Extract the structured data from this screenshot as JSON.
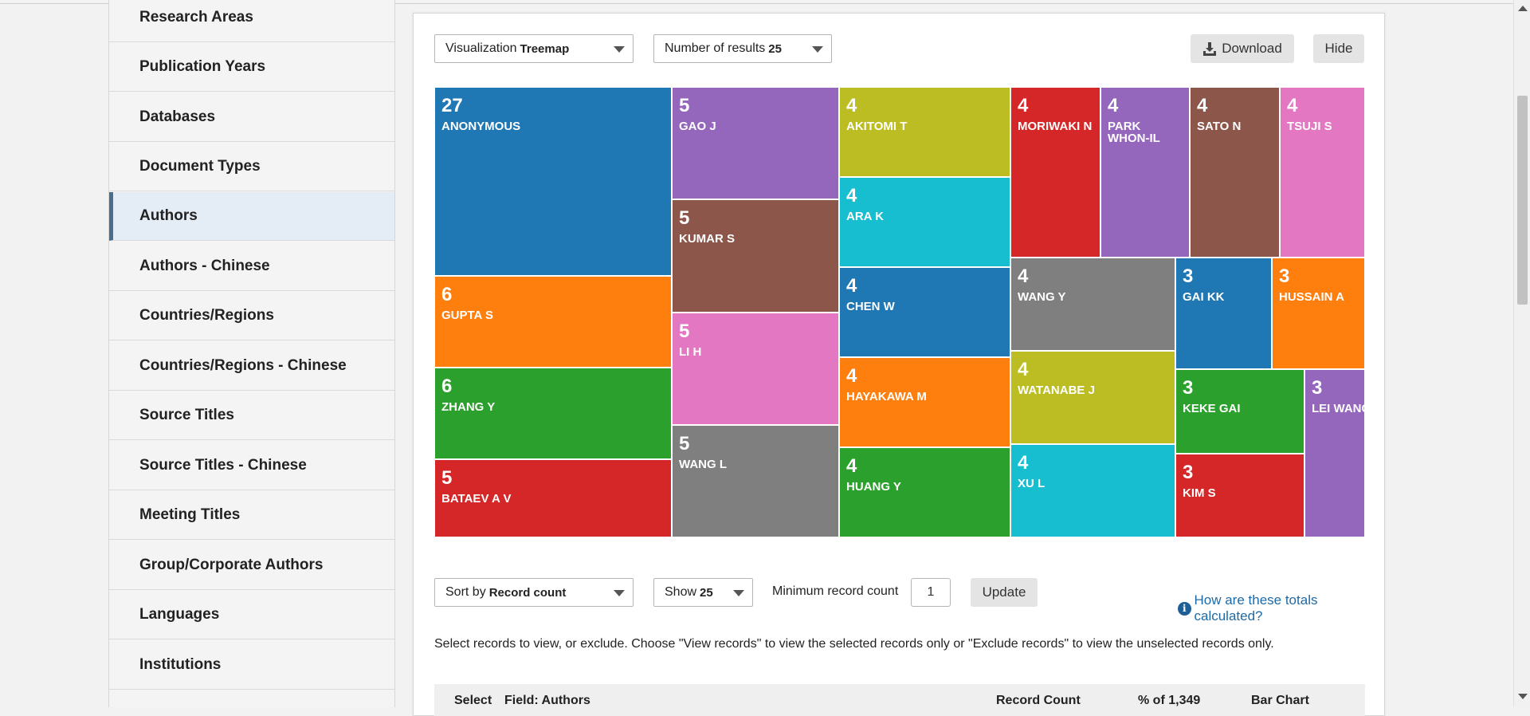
{
  "sidebar": {
    "items": [
      {
        "label": "Research Areas"
      },
      {
        "label": "Publication Years"
      },
      {
        "label": "Databases"
      },
      {
        "label": "Document Types"
      },
      {
        "label": "Authors",
        "active": true
      },
      {
        "label": "Authors - Chinese"
      },
      {
        "label": "Countries/Regions"
      },
      {
        "label": "Countries/Regions - Chinese"
      },
      {
        "label": "Source Titles"
      },
      {
        "label": "Source Titles - Chinese"
      },
      {
        "label": "Meeting Titles"
      },
      {
        "label": "Group/Corporate Authors"
      },
      {
        "label": "Languages"
      },
      {
        "label": "Institutions"
      }
    ]
  },
  "toolbar": {
    "visualization_label": "Visualization",
    "visualization_value": "Treemap",
    "results_label": "Number of results",
    "results_value": "25",
    "download_label": "Download",
    "hide_label": "Hide"
  },
  "treemap": [
    {
      "count": "27",
      "name": "ANONYMOUS",
      "color": "#1f77b4"
    },
    {
      "count": "6",
      "name": "GUPTA S",
      "color": "#ff7f0e"
    },
    {
      "count": "6",
      "name": "ZHANG Y",
      "color": "#2ca02c"
    },
    {
      "count": "5",
      "name": "BATAEV A V",
      "color": "#d62728"
    },
    {
      "count": "5",
      "name": "GAO J",
      "color": "#9467bd"
    },
    {
      "count": "5",
      "name": "KUMAR S",
      "color": "#8c564b"
    },
    {
      "count": "5",
      "name": "LI H",
      "color": "#e377c2"
    },
    {
      "count": "5",
      "name": "WANG L",
      "color": "#7f7f7f"
    },
    {
      "count": "4",
      "name": "AKITOMI T",
      "color": "#bcbd22"
    },
    {
      "count": "4",
      "name": "ARA K",
      "color": "#17becf"
    },
    {
      "count": "4",
      "name": "CHEN W",
      "color": "#1f77b4"
    },
    {
      "count": "4",
      "name": "HAYAKAWA M",
      "color": "#ff7f0e"
    },
    {
      "count": "4",
      "name": "HUANG Y",
      "color": "#2ca02c"
    },
    {
      "count": "4",
      "name": "MORIWAKI N",
      "color": "#d62728"
    },
    {
      "count": "4",
      "name": "PARK\nWHON-IL",
      "color": "#9467bd"
    },
    {
      "count": "4",
      "name": "SATO N",
      "color": "#8c564b"
    },
    {
      "count": "4",
      "name": "TSUJI S",
      "color": "#e377c2"
    },
    {
      "count": "4",
      "name": "WANG Y",
      "color": "#7f7f7f"
    },
    {
      "count": "4",
      "name": "WATANABE J",
      "color": "#bcbd22"
    },
    {
      "count": "4",
      "name": "XU L",
      "color": "#17becf"
    },
    {
      "count": "3",
      "name": "GAI KK",
      "color": "#1f77b4"
    },
    {
      "count": "3",
      "name": "HUSSAIN A",
      "color": "#ff7f0e"
    },
    {
      "count": "3",
      "name": "KEKE GAI",
      "color": "#2ca02c"
    },
    {
      "count": "3",
      "name": "KIM S",
      "color": "#d62728"
    },
    {
      "count": "3",
      "name": "LEI WANG",
      "color": "#9467bd"
    }
  ],
  "controls": {
    "sort_label": "Sort by",
    "sort_value": "Record count",
    "show_label": "Show",
    "show_value": "25",
    "min_count_label": "Minimum record count",
    "min_count_value": "1",
    "update_label": "Update",
    "help_link": "How are these totals calculated?",
    "instructions": "Select records to view, or exclude. Choose \"View records\" to view the selected records only or \"Exclude records\" to view the unselected records only."
  },
  "table": {
    "headers": [
      "Select",
      "Field: Authors",
      "Record Count",
      "% of 1,349",
      "Bar Chart"
    ]
  }
}
